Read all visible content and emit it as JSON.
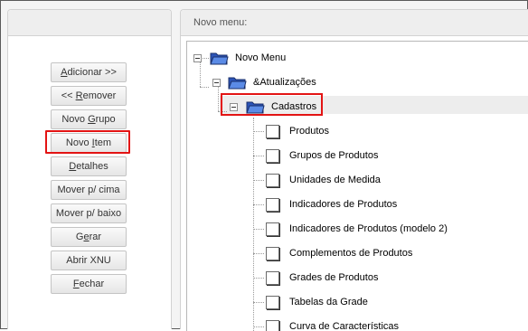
{
  "left_panel": {
    "buttons": [
      {
        "label": "Adicionar >>",
        "accel": "A"
      },
      {
        "label": "<< Remover",
        "accel": "R"
      },
      {
        "label": "Novo Grupo",
        "accel": "G"
      },
      {
        "label": "Novo Item",
        "accel": "I"
      },
      {
        "label": "Detalhes",
        "accel": "D"
      },
      {
        "label": "Mover p/ cima",
        "accel": ""
      },
      {
        "label": "Mover p/ baixo",
        "accel": ""
      },
      {
        "label": "Gerar",
        "accel": "e"
      },
      {
        "label": "Abrir XNU",
        "accel": ""
      },
      {
        "label": "Fechar",
        "accel": "F"
      }
    ],
    "highlighted_button": "Novo Item"
  },
  "right_panel": {
    "title": "Novo menu:",
    "tree": {
      "root": "Novo Menu",
      "group": "&Atualizações",
      "subgroup": "Cadastros",
      "items": [
        "Produtos",
        "Grupos de Produtos",
        "Unidades de Medida",
        "Indicadores de Produtos",
        "Indicadores de Produtos (modelo 2)",
        "Complementos de Produtos",
        "Grades de Produtos",
        "Tabelas da Grade",
        "Curva de Características"
      ]
    }
  },
  "colors": {
    "highlight": "#e31414",
    "folder": "#3d6fd6",
    "panel_header": "#eeeeee"
  }
}
